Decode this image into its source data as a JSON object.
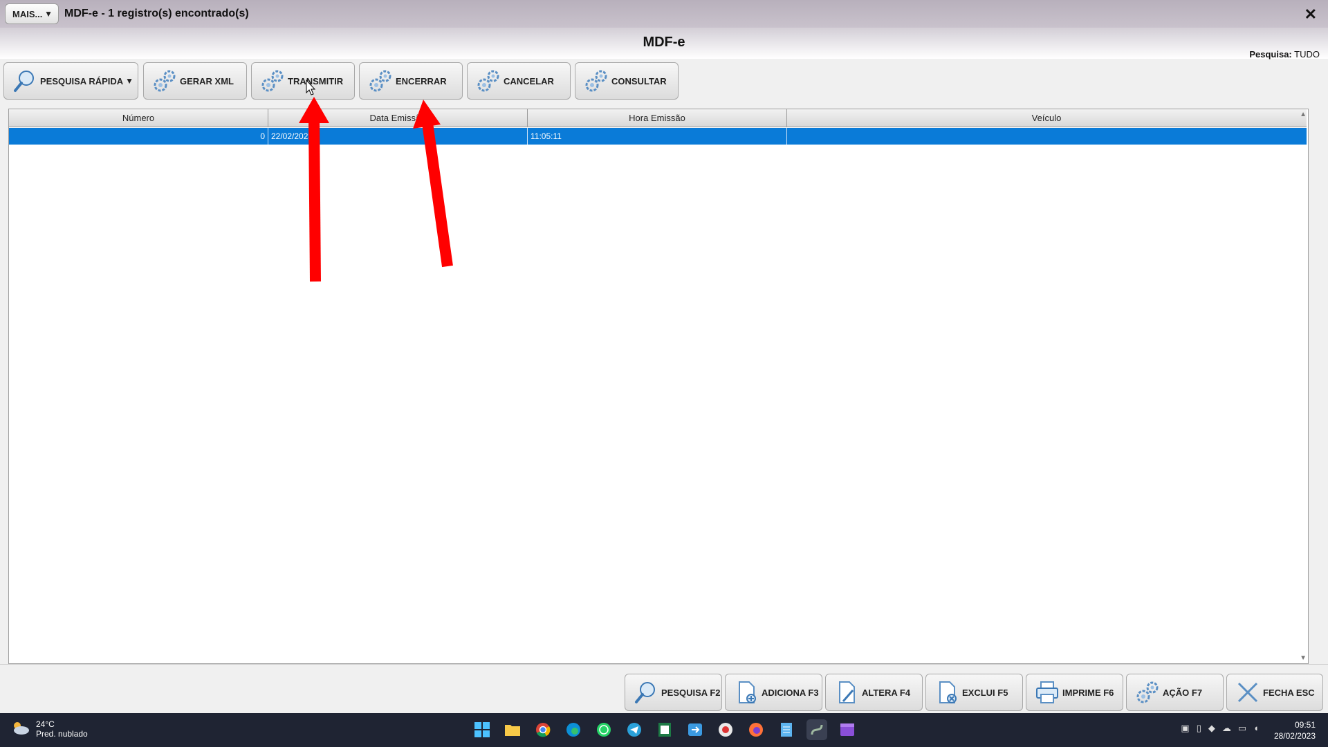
{
  "window": {
    "mais_label": "MAIS...",
    "title": "MDF-e - 1 registro(s) encontrado(s)",
    "close_glyph": "✕"
  },
  "header": {
    "title": "MDF-e",
    "search_label": "Pesquisa:",
    "search_value": "TUDO"
  },
  "toolbar": {
    "pesquisa_rapida": "PESQUISA RÁPIDA",
    "gerar_xml": "GERAR XML",
    "transmitir": "TRANSMITIR",
    "encerrar": "ENCERRAR",
    "cancelar": "CANCELAR",
    "consultar": "CONSULTAR"
  },
  "grid": {
    "columns": [
      "Número",
      "Data Emissão",
      "Hora Emissão",
      "Veículo"
    ],
    "rows": [
      {
        "numero": "0",
        "data": "22/02/2023",
        "hora": "11:05:11",
        "veiculo": ""
      }
    ]
  },
  "bottom": {
    "pesquisa": "PESQUISA F2",
    "adiciona": "ADICIONA F3",
    "altera": "ALTERA F4",
    "exclui": "EXCLUI F5",
    "imprime": "IMPRIME F6",
    "acao": "AÇÃO F7",
    "fecha": "FECHA ESC"
  },
  "taskbar": {
    "temperature": "24°C",
    "condition": "Pred. nublado",
    "time": "09:51",
    "date": "28/02/2023"
  },
  "colors": {
    "selected_row": "#0a7bd8",
    "annotation_arrow": "#ff0000",
    "taskbar": "#1f2433"
  }
}
